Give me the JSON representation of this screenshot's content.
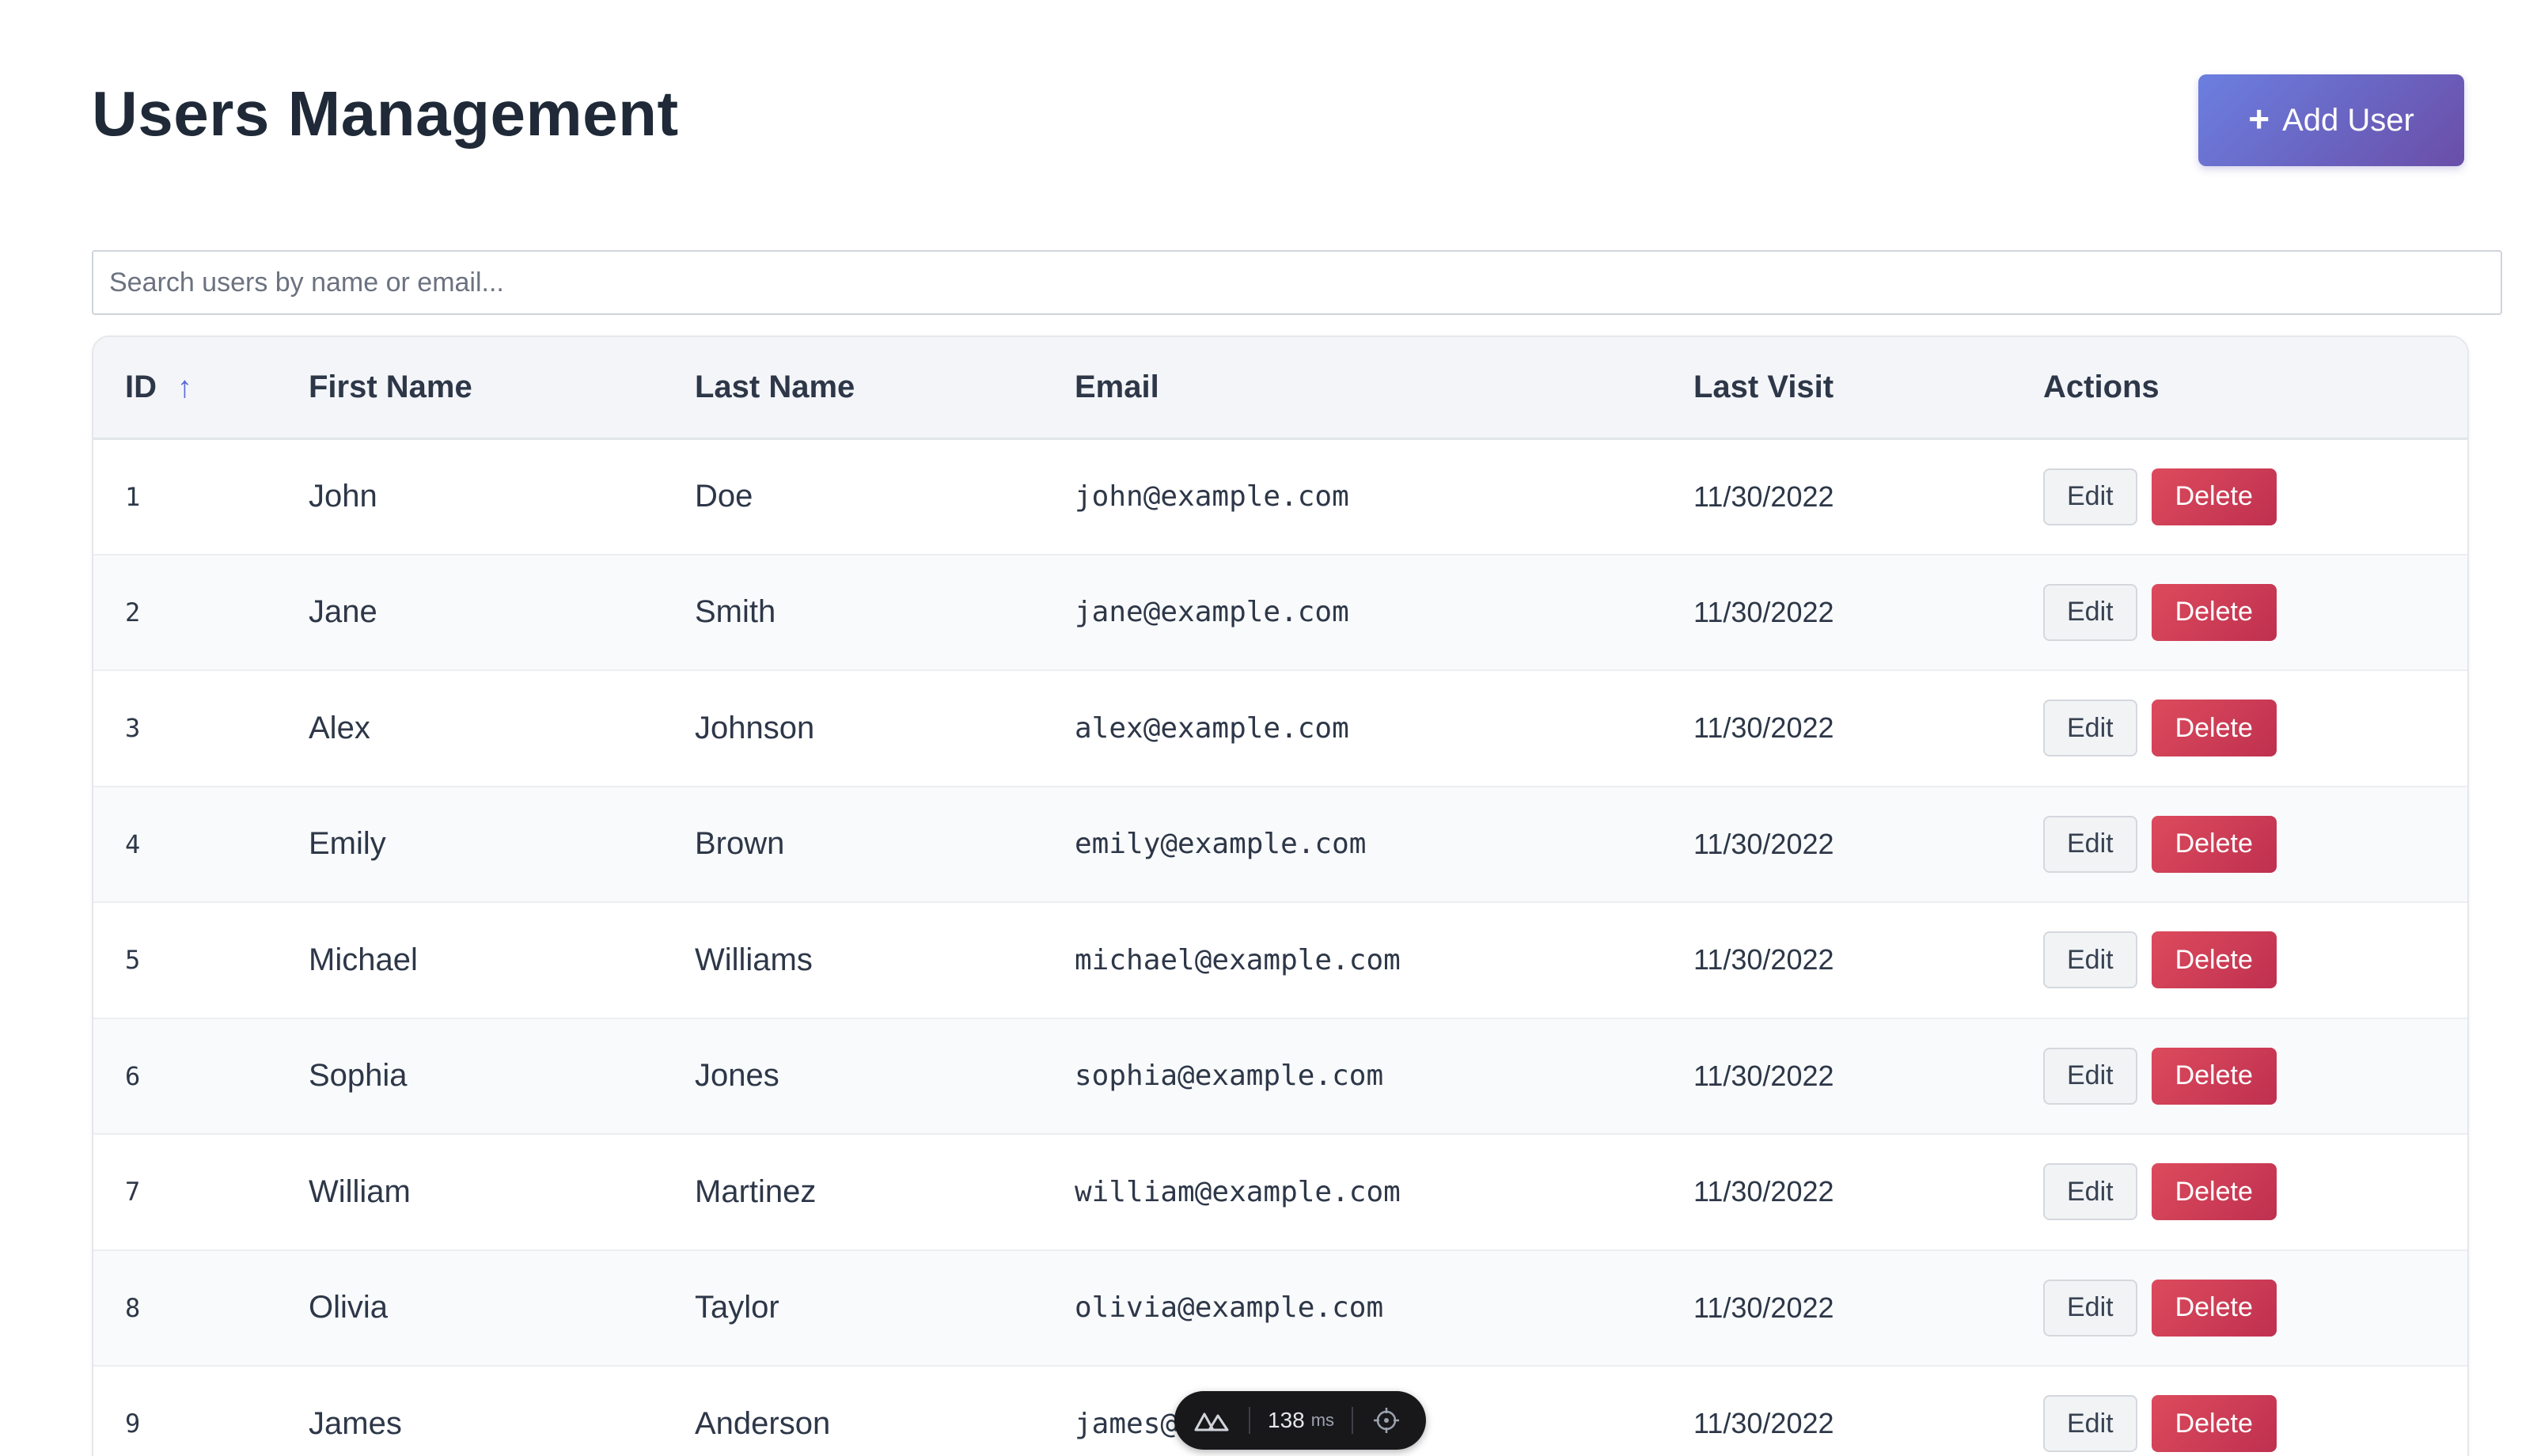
{
  "page": {
    "title": "Users Management",
    "add_button_label": "Add User",
    "add_button_icon": "plus-icon"
  },
  "search": {
    "placeholder": "Search users by name or email...",
    "value": ""
  },
  "table": {
    "columns": [
      "ID",
      "First Name",
      "Last Name",
      "Email",
      "Last Visit",
      "Actions"
    ],
    "sort_indicator": "↑",
    "sorted_column": "ID",
    "sort_direction": "ascending",
    "edit_label": "Edit",
    "delete_label": "Delete",
    "rows": [
      {
        "id": "1",
        "first": "John",
        "last": "Doe",
        "email": "john@example.com",
        "visit": "11/30/2022"
      },
      {
        "id": "2",
        "first": "Jane",
        "last": "Smith",
        "email": "jane@example.com",
        "visit": "11/30/2022"
      },
      {
        "id": "3",
        "first": "Alex",
        "last": "Johnson",
        "email": "alex@example.com",
        "visit": "11/30/2022"
      },
      {
        "id": "4",
        "first": "Emily",
        "last": "Brown",
        "email": "emily@example.com",
        "visit": "11/30/2022"
      },
      {
        "id": "5",
        "first": "Michael",
        "last": "Williams",
        "email": "michael@example.com",
        "visit": "11/30/2022"
      },
      {
        "id": "6",
        "first": "Sophia",
        "last": "Jones",
        "email": "sophia@example.com",
        "visit": "11/30/2022"
      },
      {
        "id": "7",
        "first": "William",
        "last": "Martinez",
        "email": "william@example.com",
        "visit": "11/30/2022"
      },
      {
        "id": "8",
        "first": "Olivia",
        "last": "Taylor",
        "email": "olivia@example.com",
        "visit": "11/30/2022"
      },
      {
        "id": "9",
        "first": "James",
        "last": "Anderson",
        "email": "james@example.com",
        "visit": "11/30/2022"
      }
    ]
  },
  "perf_overlay": {
    "value": "138",
    "unit": "ms",
    "logo_icon": "nuxt-logo-icon",
    "target_icon": "crosshair-icon"
  },
  "colors": {
    "accent_gradient_start": "#6b7fe0",
    "accent_gradient_end": "#6a4ea8",
    "delete": "#d03c55",
    "sort_arrow": "#5a67d8"
  }
}
